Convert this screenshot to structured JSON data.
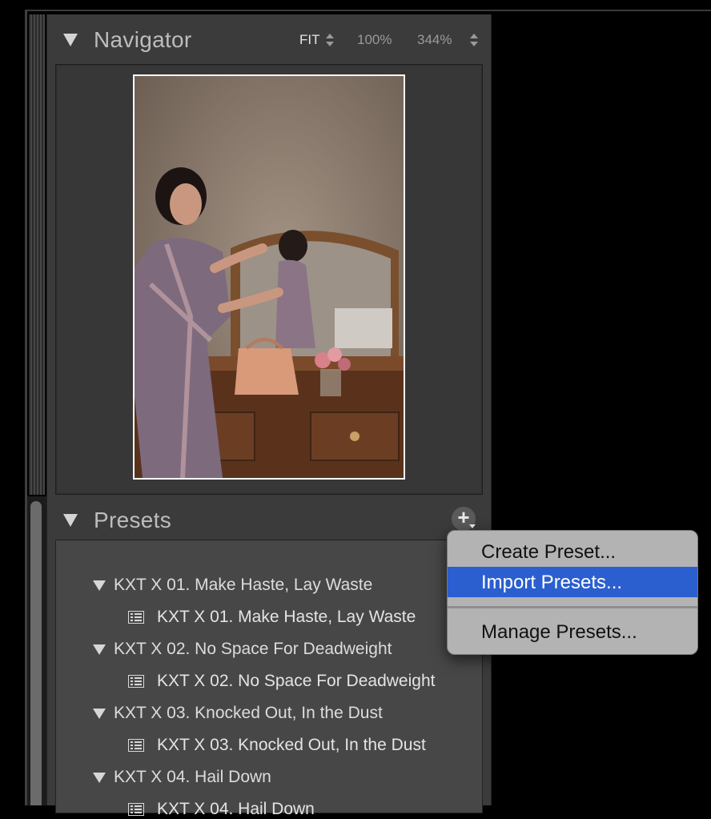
{
  "navigator": {
    "title": "Navigator",
    "zoom_fit": "FIT",
    "zoom_100": "100%",
    "zoom_custom": "344%"
  },
  "presets": {
    "title": "Presets",
    "add_label": "+",
    "groups": [
      {
        "folder": "KXT X 01. Make Haste, Lay Waste",
        "item": "KXT X 01. Make Haste, Lay Waste"
      },
      {
        "folder": "KXT X 02. No Space For Deadweight",
        "item": "KXT X 02. No Space For Deadweight"
      },
      {
        "folder": "KXT X 03. Knocked Out, In the Dust",
        "item": "KXT X 03. Knocked Out, In the Dust"
      },
      {
        "folder": "KXT X 04. Hail Down",
        "item": "KXT X 04. Hail Down"
      }
    ]
  },
  "context_menu": {
    "items": [
      "Create Preset...",
      "Import Presets...",
      "Manage Presets..."
    ],
    "selected": "Import Presets...",
    "highlight_color": "#2b5fd0"
  },
  "icons": {
    "collapse": "disclosure-triangle-icon",
    "preset": "preset-list-icon",
    "add": "plus-icon"
  }
}
